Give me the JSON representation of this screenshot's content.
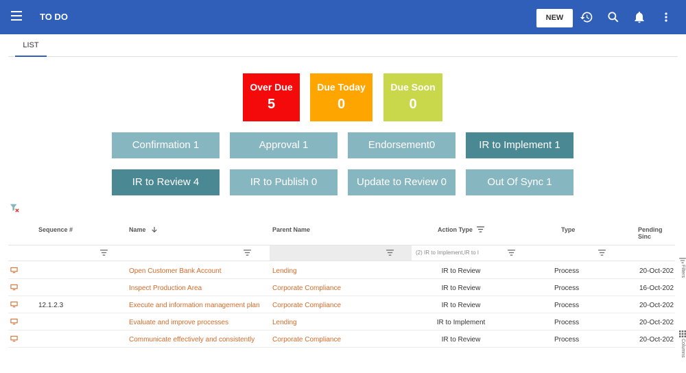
{
  "header": {
    "title": "TO DO",
    "new_label": "NEW"
  },
  "tabs": [
    {
      "label": "LIST"
    }
  ],
  "due_cards": [
    {
      "label": "Over Due",
      "count": "5",
      "color": "#f40a0a"
    },
    {
      "label": "Due Today",
      "count": "0",
      "color": "#ffa500"
    },
    {
      "label": "Due Soon",
      "count": "0",
      "color": "#c9d84a"
    }
  ],
  "categories": [
    {
      "label": "Confirmation 1",
      "style": "light"
    },
    {
      "label": "Approval 1",
      "style": "light"
    },
    {
      "label": "Endorsement0",
      "style": "light"
    },
    {
      "label": "IR to Implement 1",
      "style": "dark"
    },
    {
      "label": "IR to Review 4",
      "style": "dark"
    },
    {
      "label": "IR to Publish 0",
      "style": "light"
    },
    {
      "label": "Update to Review 0",
      "style": "light"
    },
    {
      "label": "Out Of Sync 1",
      "style": "light"
    }
  ],
  "table": {
    "columns": [
      "Sequence #",
      "Name",
      "Parent Name",
      "Action Type",
      "Type",
      "Pending Sinc"
    ],
    "action_type_filter": "(2) IR to Implement,IR to I",
    "rows": [
      {
        "sequence": "",
        "name": "Open Customer Bank Account",
        "parent": "Lending",
        "action": "IR to Review",
        "type": "Process",
        "pending": "20-Oct-202"
      },
      {
        "sequence": "",
        "name": "Inspect Production Area",
        "parent": "Corporate Compliance",
        "action": "IR to Review",
        "type": "Process",
        "pending": "16-Oct-202"
      },
      {
        "sequence": "12.1.2.3",
        "name": "Execute and information management plan",
        "parent": "Corporate Compliance",
        "action": "IR to Review",
        "type": "Process",
        "pending": "20-Oct-202"
      },
      {
        "sequence": "",
        "name": "Evaluate and improve processes",
        "parent": "Lending",
        "action": "IR to Implement",
        "type": "Process",
        "pending": "20-Oct-202"
      },
      {
        "sequence": "",
        "name": "Communicate effectively and consistently",
        "parent": "Corporate Compliance",
        "action": "IR to Review",
        "type": "Process",
        "pending": "20-Oct-202"
      }
    ]
  },
  "side_panel": {
    "filters_label": "Filters",
    "columns_label": "Columns"
  },
  "colors": {
    "accent": "#2f5fb8",
    "link": "#d46b2a",
    "cat_light": "#86b6c0",
    "cat_dark": "#4a8893"
  }
}
